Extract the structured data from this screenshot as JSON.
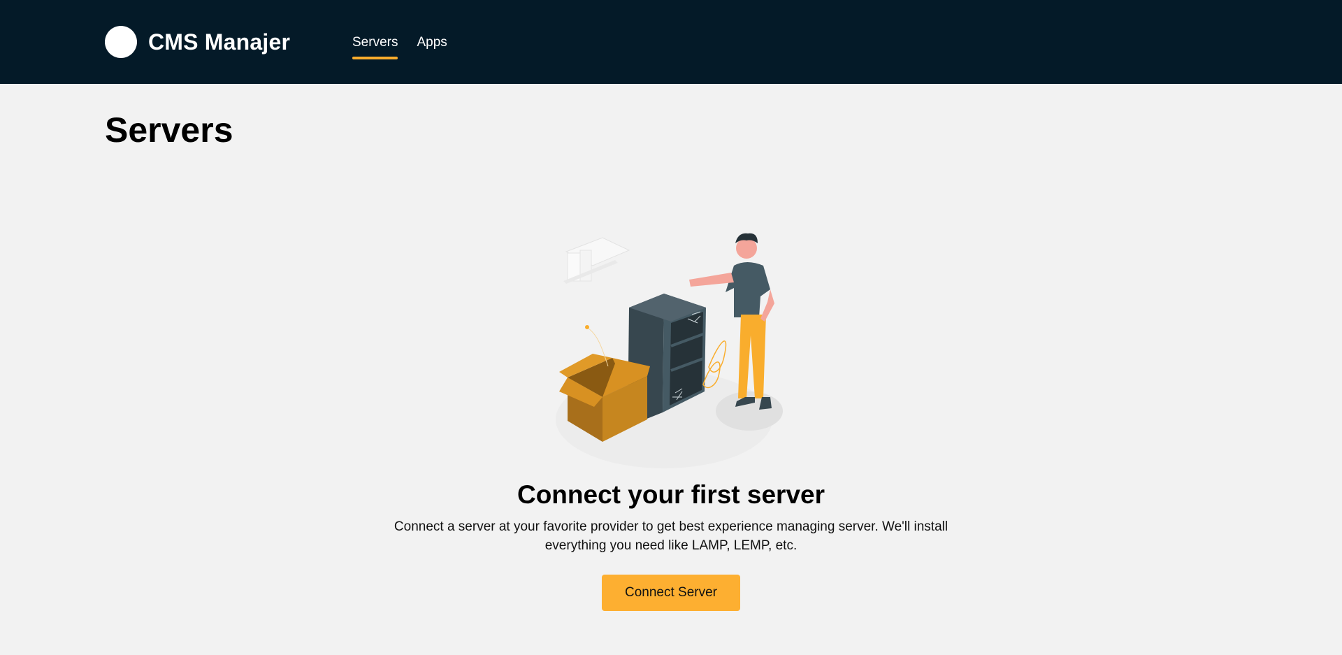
{
  "header": {
    "app_name": "CMS Manajer",
    "nav": [
      {
        "label": "Servers",
        "active": true
      },
      {
        "label": "Apps",
        "active": false
      }
    ]
  },
  "main": {
    "title": "Servers",
    "empty_state": {
      "heading": "Connect your first server",
      "description": "Connect a server at your favorite provider to get best experience managing server. We'll install everything you need like LAMP, LEMP, etc.",
      "button_label": "Connect Server",
      "illustration": "person-with-empty-server-rack-and-open-box"
    }
  },
  "colors": {
    "header_bg": "#041a28",
    "page_bg": "#f2f2f2",
    "accent": "#fdaf31"
  }
}
